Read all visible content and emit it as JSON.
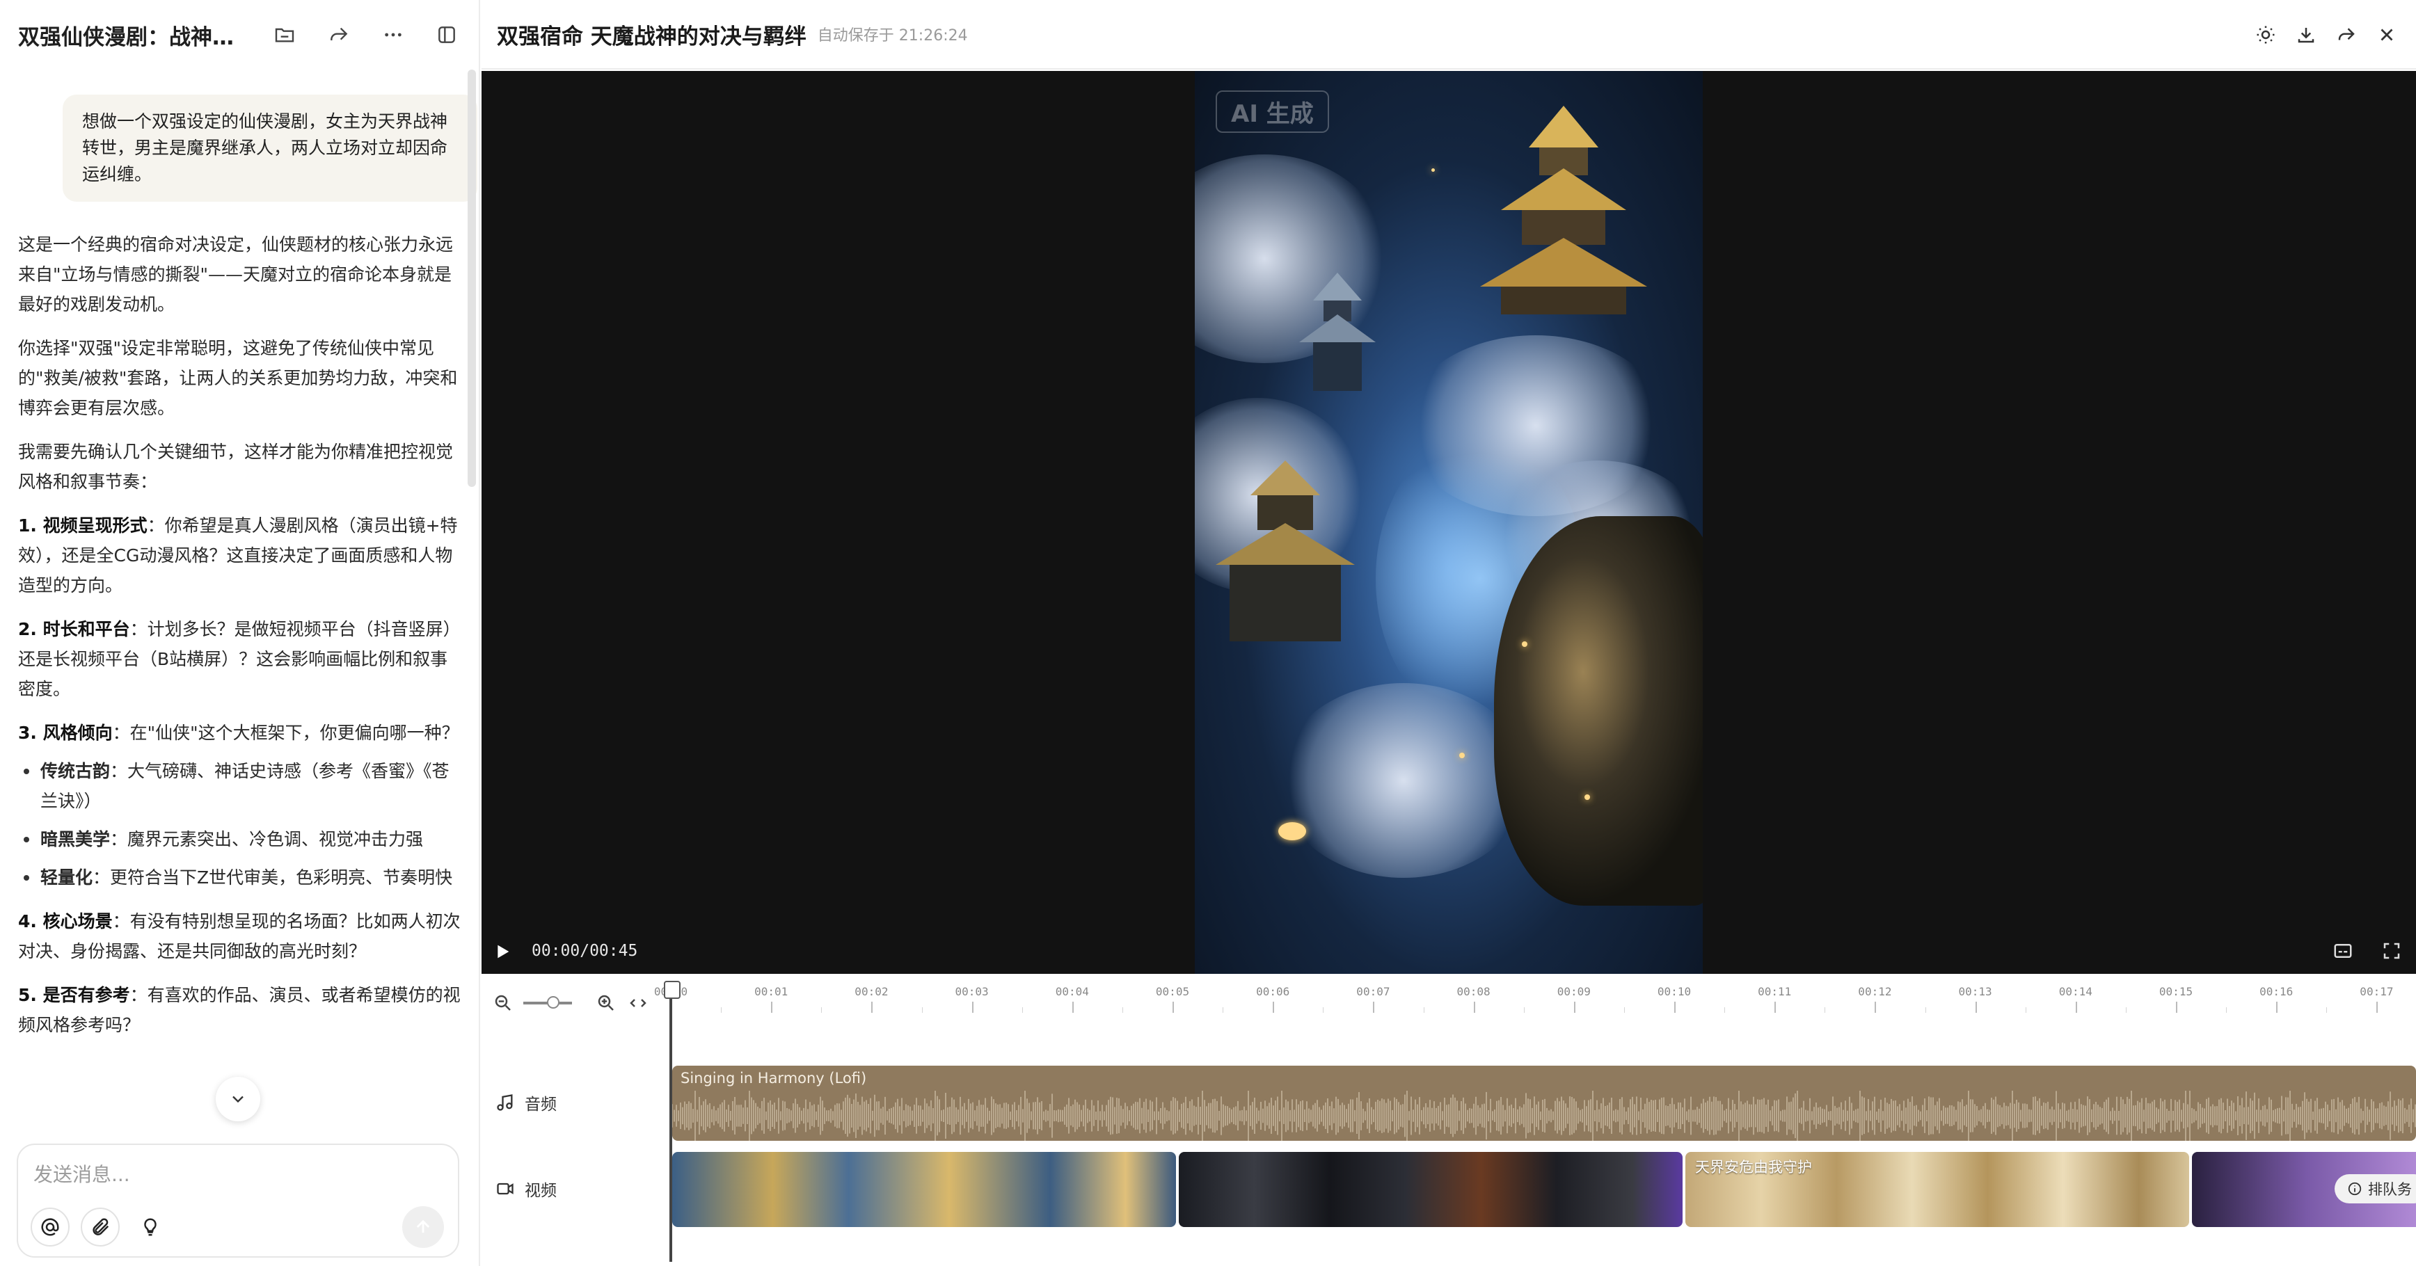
{
  "left": {
    "title": "双强仙侠漫剧：战神魔…",
    "user_message": "想做一个双强设定的仙侠漫剧，女主为天界战神转世，男主是魔界继承人，两人立场对立却因命运纠缠。",
    "paragraphs": [
      "这是一个经典的宿命对决设定，仙侠题材的核心张力永远来自\"立场与情感的撕裂\"——天魔对立的宿命论本身就是最好的戏剧发动机。",
      "你选择\"双强\"设定非常聪明，这避免了传统仙侠中常见的\"救美/被救\"套路，让两人的关系更加势均力敌，冲突和博弈会更有层次感。",
      "我需要先确认几个关键细节，这样才能为你精准把控视觉风格和叙事节奏："
    ],
    "questions": [
      {
        "head": "1. 视频呈现形式",
        "body": "：你希望是真人漫剧风格（演员出镜+特效），还是全CG动漫风格？这直接决定了画面质感和人物造型的方向。"
      },
      {
        "head": "2. 时长和平台",
        "body": "：计划多长？是做短视频平台（抖音竖屏）还是长视频平台（B站横屏）？这会影响画幅比例和叙事密度。"
      },
      {
        "head": "3. 风格倾向",
        "body": "：在\"仙侠\"这个大框架下，你更偏向哪一种？"
      }
    ],
    "bullets": [
      {
        "head": "传统古韵",
        "body": "：大气磅礴、神话史诗感（参考《香蜜》《苍兰诀》）"
      },
      {
        "head": "暗黑美学",
        "body": "：魔界元素突出、冷色调、视觉冲击力强"
      },
      {
        "head": "轻量化",
        "body": "：更符合当下Z世代审美，色彩明亮、节奏明快"
      }
    ],
    "questions2": [
      {
        "head": "4. 核心场景",
        "body": "：有没有特别想呈现的名场面？比如两人初次对决、身份揭露、还是共同御敌的高光时刻？"
      },
      {
        "head": "5. 是否有参考",
        "body": "：有喜欢的作品、演员、或者希望模仿的视频风格参考吗？"
      }
    ],
    "composer_placeholder": "发送消息..."
  },
  "editor": {
    "title": "双强宿命 天魔战神的对决与羁绊",
    "autosave": "自动保存于 21:26:24",
    "ai_badge": "AI 生成",
    "time": "00:00/00:45",
    "ticks": [
      "00:00",
      "00:01",
      "00:02",
      "00:03",
      "00:04",
      "00:05",
      "00:06",
      "00:07",
      "00:08",
      "00:09",
      "00:10",
      "00:11",
      "00:12",
      "00:13",
      "00:14",
      "00:15",
      "00:16",
      "00:17"
    ],
    "audio_track_label": "音频",
    "video_track_label": "视频",
    "audio_clip_name": "Singing in Harmony (Lofi)",
    "clip3_name": "天界安危由我守护",
    "queue_label": "排队务"
  }
}
